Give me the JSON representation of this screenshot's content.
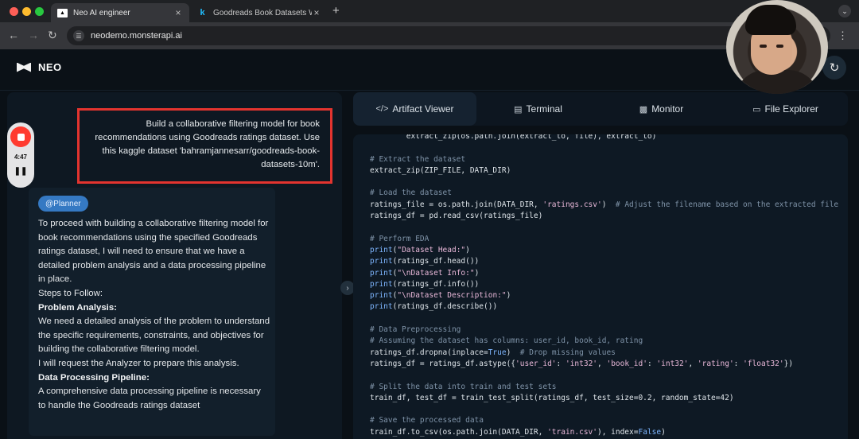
{
  "browser": {
    "tabs": [
      {
        "title": "Neo AI engineer",
        "favicon": "neo-logo-icon"
      },
      {
        "title": "Goodreads Book Datasets W",
        "favicon": "kaggle-icon"
      }
    ],
    "url": "neodemo.monsterapi.ai"
  },
  "app": {
    "logo_text": "NEO"
  },
  "recorder": {
    "time": "4:47"
  },
  "chat": {
    "user_message": "Build a collaborative filtering model for book recommendations using Goodreads ratings dataset. Use this kaggle dataset 'bahramjannesarr/goodreads-book-datasets-10m'.",
    "ai_message": {
      "badge": "@Planner",
      "intro": "To proceed with building a collaborative filtering model for book recommendations using the specified Goodreads ratings dataset, I will need to ensure that we have a detailed problem analysis and a data processing pipeline in place.",
      "steps_label": "Steps to Follow:",
      "section1_title": "Problem Analysis:",
      "section1_text": "We need a detailed analysis of the problem to understand the specific requirements, constraints, and objectives for building the collaborative filtering model.",
      "section1_action": "I will request the Analyzer to prepare this analysis.",
      "section2_title": "Data Processing Pipeline:",
      "section2_text": "A comprehensive data processing pipeline is necessary to handle the Goodreads ratings dataset"
    }
  },
  "panel": {
    "tabs": [
      {
        "label": "Artifact Viewer",
        "icon": "code-icon",
        "active": true
      },
      {
        "label": "Terminal",
        "icon": "terminal-icon",
        "active": false
      },
      {
        "label": "Monitor",
        "icon": "chart-icon",
        "active": false
      },
      {
        "label": "File Explorer",
        "icon": "monitor-icon",
        "active": false
      }
    ],
    "code_lines": [
      [
        {
          "t": "        extract_zip(os.path.join(extract_to, file), extract_to)"
        }
      ],
      [
        {
          "t": ""
        }
      ],
      [
        {
          "c": "cm",
          "t": "# Extract the dataset"
        }
      ],
      [
        {
          "t": "extract_zip(ZIP_FILE, DATA_DIR)"
        }
      ],
      [
        {
          "t": ""
        }
      ],
      [
        {
          "c": "cm",
          "t": "# Load the dataset"
        }
      ],
      [
        {
          "t": "ratings_file = os.path.join(DATA_DIR, "
        },
        {
          "c": "st",
          "t": "'ratings.csv'"
        },
        {
          "t": ")  "
        },
        {
          "c": "cm",
          "t": "# Adjust the filename based on the extracted file"
        }
      ],
      [
        {
          "t": "ratings_df = pd.read_csv(ratings_file)"
        }
      ],
      [
        {
          "t": ""
        }
      ],
      [
        {
          "c": "cm",
          "t": "# Perform EDA"
        }
      ],
      [
        {
          "c": "kw",
          "t": "print"
        },
        {
          "t": "("
        },
        {
          "c": "st",
          "t": "\"Dataset Head:\""
        },
        {
          "t": ")"
        }
      ],
      [
        {
          "c": "kw",
          "t": "print"
        },
        {
          "t": "(ratings_df.head())"
        }
      ],
      [
        {
          "c": "kw",
          "t": "print"
        },
        {
          "t": "("
        },
        {
          "c": "st",
          "t": "\"\\nDataset Info:\""
        },
        {
          "t": ")"
        }
      ],
      [
        {
          "c": "kw",
          "t": "print"
        },
        {
          "t": "(ratings_df.info())"
        }
      ],
      [
        {
          "c": "kw",
          "t": "print"
        },
        {
          "t": "("
        },
        {
          "c": "st",
          "t": "\"\\nDataset Description:\""
        },
        {
          "t": ")"
        }
      ],
      [
        {
          "c": "kw",
          "t": "print"
        },
        {
          "t": "(ratings_df.describe())"
        }
      ],
      [
        {
          "t": ""
        }
      ],
      [
        {
          "c": "cm",
          "t": "# Data Preprocessing"
        }
      ],
      [
        {
          "c": "cm",
          "t": "# Assuming the dataset has columns: user_id, book_id, rating"
        }
      ],
      [
        {
          "t": "ratings_df.dropna(inplace="
        },
        {
          "c": "kw",
          "t": "True"
        },
        {
          "t": ")  "
        },
        {
          "c": "cm",
          "t": "# Drop missing values"
        }
      ],
      [
        {
          "t": "ratings_df = ratings_df.astype({"
        },
        {
          "c": "st",
          "t": "'user_id'"
        },
        {
          "t": ": "
        },
        {
          "c": "st",
          "t": "'int32'"
        },
        {
          "t": ", "
        },
        {
          "c": "st",
          "t": "'book_id'"
        },
        {
          "t": ": "
        },
        {
          "c": "st",
          "t": "'int32'"
        },
        {
          "t": ", "
        },
        {
          "c": "st",
          "t": "'rating'"
        },
        {
          "t": ": "
        },
        {
          "c": "st",
          "t": "'float32'"
        },
        {
          "t": "})"
        }
      ],
      [
        {
          "t": ""
        }
      ],
      [
        {
          "c": "cm",
          "t": "# Split the data into train and test sets"
        }
      ],
      [
        {
          "t": "train_df, test_df = train_test_split(ratings_df, test_size=0.2, random_state=42)"
        }
      ],
      [
        {
          "t": ""
        }
      ],
      [
        {
          "c": "cm",
          "t": "# Save the processed data"
        }
      ],
      [
        {
          "t": "train_df.to_csv(os.path.join(DATA_DIR, "
        },
        {
          "c": "st",
          "t": "'train.csv'"
        },
        {
          "t": "), index="
        },
        {
          "c": "kw",
          "t": "False"
        },
        {
          "t": ")"
        }
      ]
    ]
  },
  "colors": {
    "accent": "#3579c3",
    "highlight_box": "#e3342f",
    "record": "#ff3b30"
  }
}
